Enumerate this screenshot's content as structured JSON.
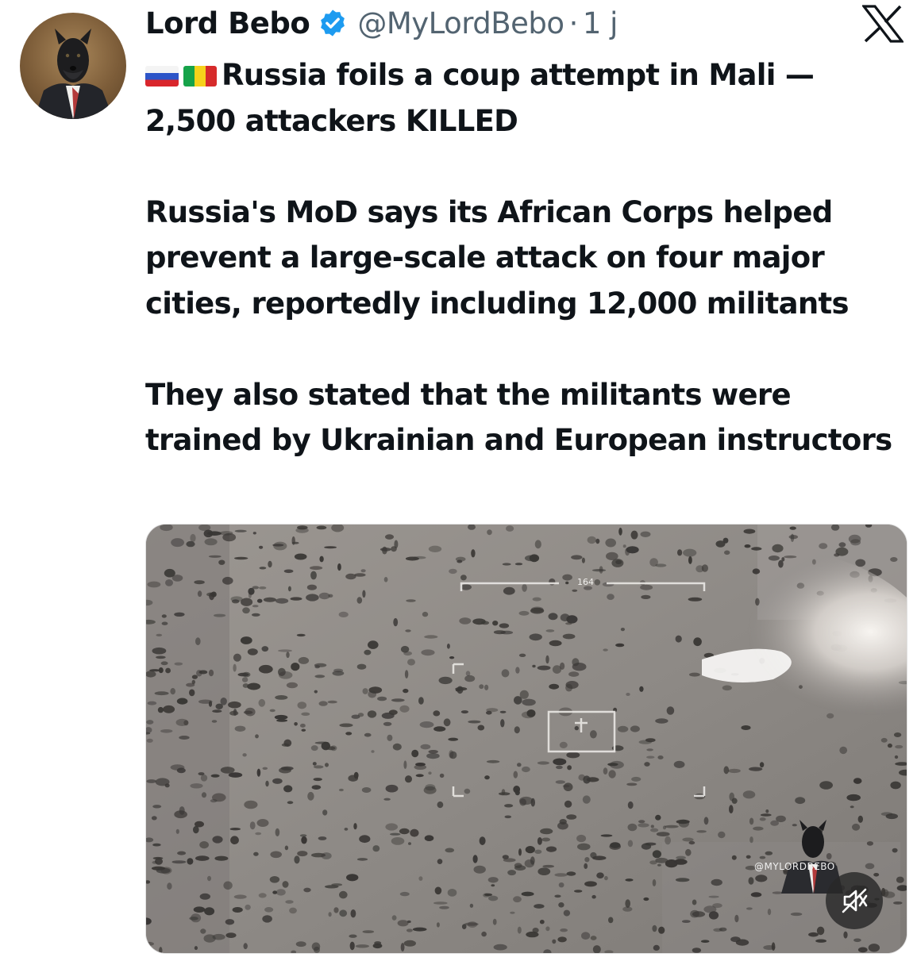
{
  "author": {
    "display_name": "Lord Bebo",
    "handle": "@MyLordBebo",
    "separator": "·",
    "age": "1 j",
    "avatar_icon": "dog-in-suit-avatar",
    "verified_icon": "verified-badge-icon",
    "verified_color": "#1d9bf0"
  },
  "platform_logo": "x-logo-icon",
  "tweet": {
    "flags": [
      "russia-flag-icon",
      "mali-flag-icon"
    ],
    "headline": "Russia foils a coup attempt in Mali —",
    "headline_line2": "2,500 attackers KILLED",
    "paragraph1": "Russia's MoD says its African Corps helped prevent a large-scale attack on four major cities, reportedly including 12,000 militants",
    "paragraph2": "They also stated that the militants were trained by Ukrainian and European instructors"
  },
  "media": {
    "type": "video",
    "hud_readout": "164",
    "watermark": "@MYLORDBEBO",
    "mute_icon": "speaker-muted-icon"
  },
  "colors": {
    "text": "#0f1419",
    "secondary": "#536471",
    "background": "#ffffff"
  }
}
